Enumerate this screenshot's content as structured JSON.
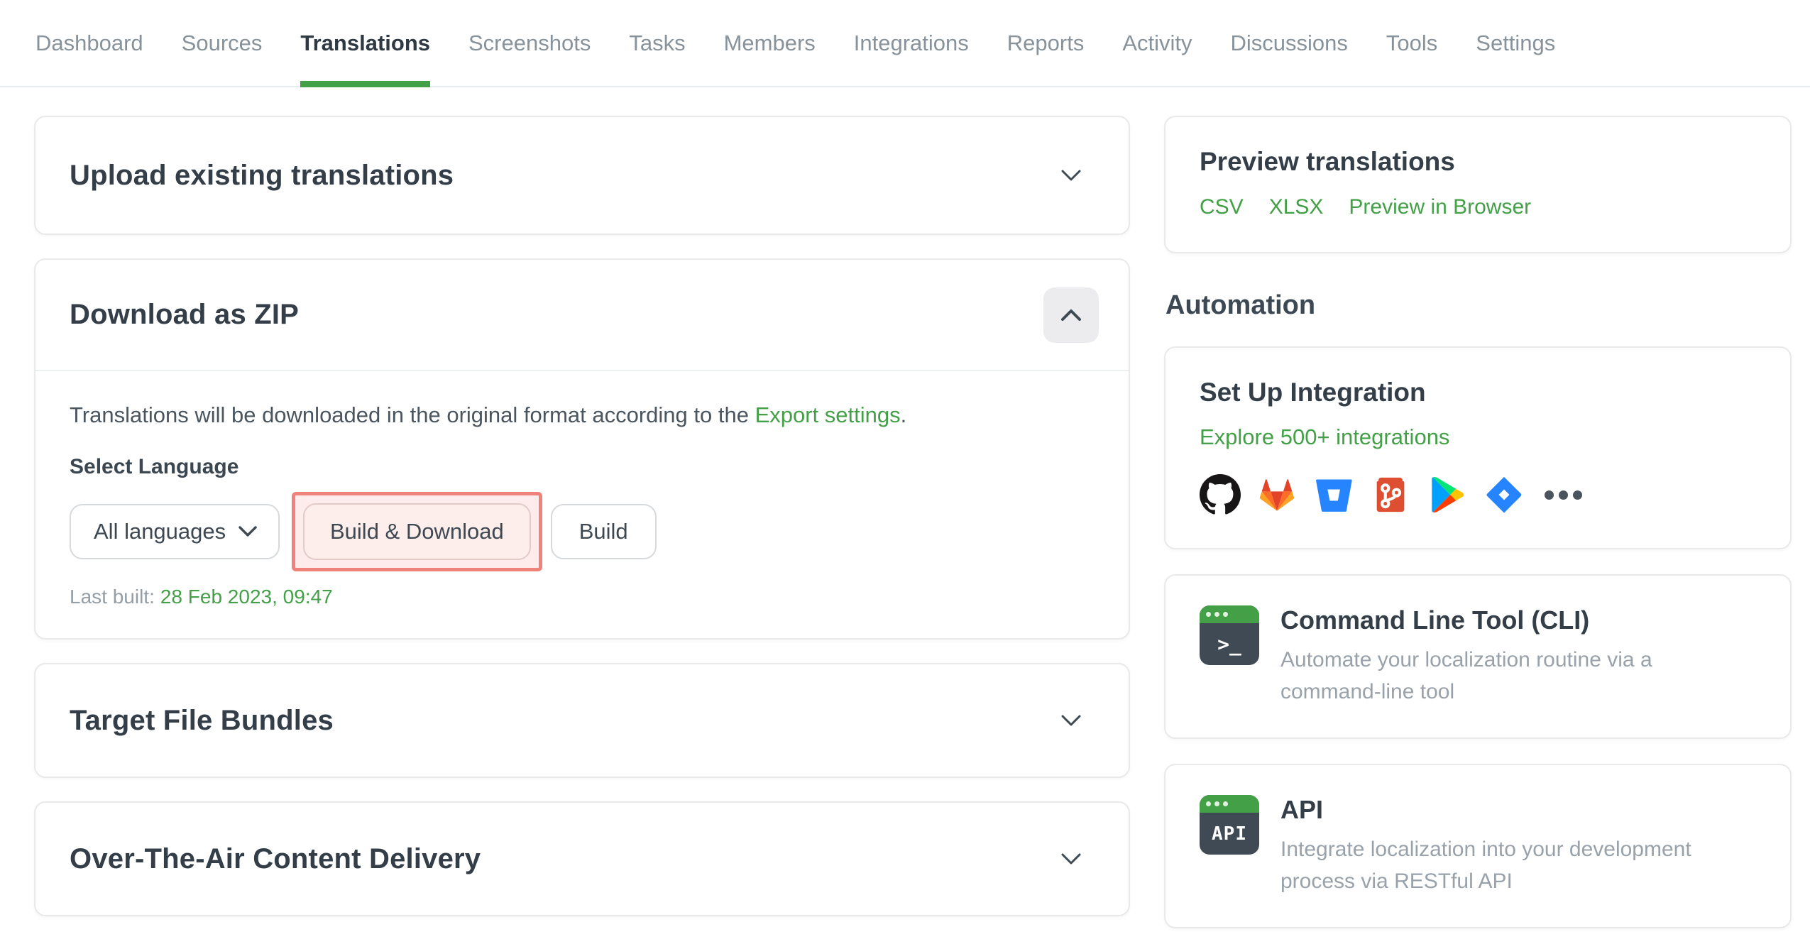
{
  "nav": {
    "items": [
      {
        "label": "Dashboard",
        "active": false
      },
      {
        "label": "Sources",
        "active": false
      },
      {
        "label": "Translations",
        "active": true
      },
      {
        "label": "Screenshots",
        "active": false
      },
      {
        "label": "Tasks",
        "active": false
      },
      {
        "label": "Members",
        "active": false
      },
      {
        "label": "Integrations",
        "active": false
      },
      {
        "label": "Reports",
        "active": false
      },
      {
        "label": "Activity",
        "active": false
      },
      {
        "label": "Discussions",
        "active": false
      },
      {
        "label": "Tools",
        "active": false
      },
      {
        "label": "Settings",
        "active": false
      }
    ]
  },
  "main": {
    "upload": {
      "title": "Upload existing translations"
    },
    "download": {
      "title": "Download as ZIP",
      "description_prefix": "Translations will be downloaded in the original format according to the ",
      "description_link": "Export settings",
      "description_suffix": ".",
      "select_label": "Select Language",
      "language_value": "All languages",
      "build_download_label": "Build & Download",
      "build_label": "Build",
      "last_built_label": "Last built:",
      "last_built_value": "28 Feb 2023, 09:47"
    },
    "bundles": {
      "title": "Target File Bundles"
    },
    "ota": {
      "title": "Over-The-Air Content Delivery"
    }
  },
  "sidebar": {
    "preview": {
      "title": "Preview translations",
      "links": [
        "CSV",
        "XLSX",
        "Preview in Browser"
      ]
    },
    "automation_heading": "Automation",
    "integration": {
      "title": "Set Up Integration",
      "link": "Explore 500+ integrations",
      "icons": [
        "github",
        "gitlab",
        "bitbucket",
        "git",
        "google-play",
        "jira",
        "more"
      ]
    },
    "cli": {
      "title": "Command Line Tool (CLI)",
      "description": "Automate your localization routine via a command-line tool",
      "icon_text": ">_"
    },
    "api": {
      "title": "API",
      "description": "Integrate localization into your development process via RESTful API",
      "icon_text": "API"
    }
  },
  "colors": {
    "accent_green": "#43a047",
    "highlight_border": "#ef837c",
    "highlight_fill": "#fdeceb",
    "title_dark": "#333e48",
    "nav_inactive": "#87929b"
  }
}
